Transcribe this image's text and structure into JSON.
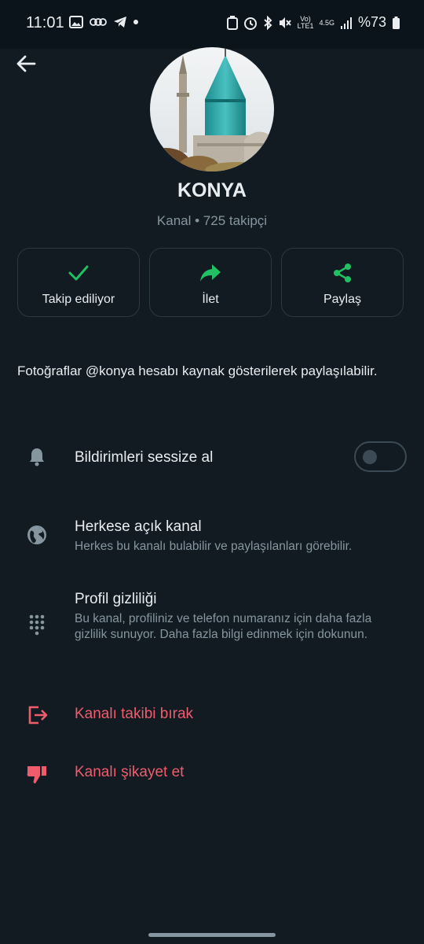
{
  "status_bar": {
    "time": "11:01",
    "battery": "%73",
    "network": "4.5G",
    "volte": "Vo)\nLTE1"
  },
  "channel": {
    "name": "KONYA",
    "subtitle": "Kanal • 725 takipçi",
    "description": "Fotoğraflar @konya hesabı kaynak gösterilerek paylaşılabilir."
  },
  "actions": [
    {
      "label": "Takip ediliyor",
      "icon": "check-icon"
    },
    {
      "label": "İlet",
      "icon": "forward-icon"
    },
    {
      "label": "Paylaş",
      "icon": "share-icon"
    }
  ],
  "settings": {
    "mute": {
      "title": "Bildirimleri sessize al",
      "icon": "bell-icon",
      "enabled": false
    },
    "public": {
      "title": "Herkese açık kanal",
      "detail": "Herkes bu kanalı bulabilir ve paylaşılanları görebilir.",
      "icon": "globe-icon"
    },
    "privacy": {
      "title": "Profil gizliliği",
      "detail": "Bu kanal, profiliniz ve telefon numaranız için daha fazla gizlilik sunuyor. Daha fazla bilgi edinmek için dokunun.",
      "icon": "dialpad-icon"
    },
    "unfollow": {
      "title": "Kanalı takibi bırak",
      "icon": "exit-icon"
    },
    "report": {
      "title": "Kanalı şikayet et",
      "icon": "thumbs-down-icon"
    }
  },
  "colors": {
    "accent": "#21c063",
    "danger": "#f15c6d",
    "background": "#111b21",
    "muted": "#8696a0"
  }
}
